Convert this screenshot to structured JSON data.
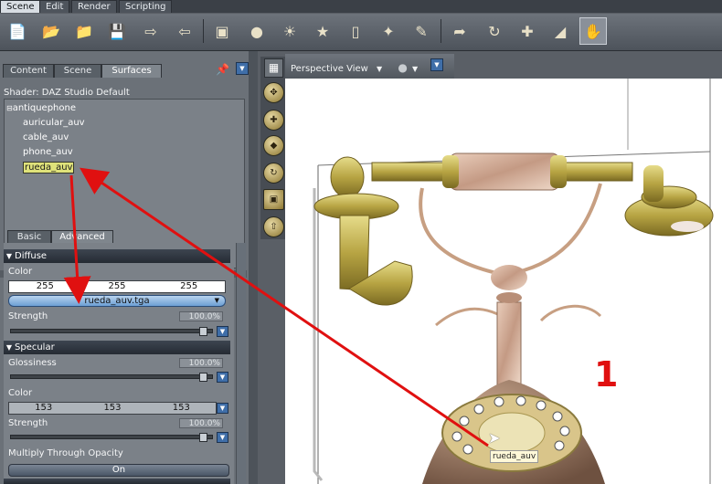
{
  "menu": {
    "tabs": [
      "Scene",
      "Edit",
      "Render",
      "Scripting"
    ],
    "active": "Scene"
  },
  "toolbar": {
    "icons": [
      "new-file-icon",
      "open-file-icon",
      "merge-icon",
      "save-icon",
      "import-icon",
      "export-icon",
      "camera-icon",
      "bulb-icon",
      "sun-icon",
      "spotlight-icon",
      "primitive-cube-icon",
      "bone-icon",
      "pencil-icon",
      "select-arrow-icon",
      "rotate-icon",
      "translate-icon",
      "scale-icon",
      "active-pose-icon"
    ]
  },
  "left_panel": {
    "tabs": [
      "Content",
      "Scene",
      "Surfaces"
    ],
    "active_tab": "Surfaces",
    "shader_label": "Shader: DAZ Studio Default",
    "tree": {
      "root": "antiquephone",
      "children": [
        "auricular_auv",
        "cable_auv",
        "phone_auv",
        "rueda_auv"
      ],
      "selected": "rueda_auv"
    },
    "sub_tabs": [
      "Basic",
      "Advanced"
    ],
    "active_sub_tab": "Advanced",
    "diffuse": {
      "header": "Diffuse",
      "color_label": "Color",
      "color_rgb": [
        "255",
        "255",
        "255"
      ],
      "texture": "rueda_auv.tga",
      "strength_label": "Strength",
      "strength_value": "100.0%"
    },
    "specular": {
      "header": "Specular",
      "glossiness_label": "Glossiness",
      "glossiness_value": "100.0%",
      "color_label": "Color",
      "color_rgb": [
        "153",
        "153",
        "153"
      ],
      "strength_label": "Strength",
      "strength_value": "100.0%"
    },
    "multiply_label": "Multiply Through Opacity",
    "multiply_value": "On"
  },
  "viewport": {
    "camera_label": "Perspective View",
    "annotation_number": "1",
    "tooltip": "rueda_auv"
  },
  "colors": {
    "annotation_red": "#e01010",
    "selection_yellow": "#dfe27a",
    "brass": "#c9b552"
  }
}
